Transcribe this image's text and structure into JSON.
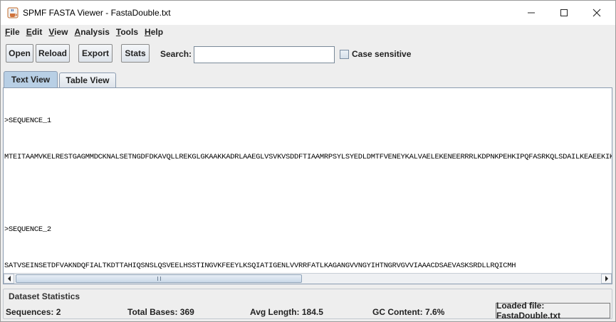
{
  "window": {
    "title": "SPMF FASTA Viewer - FastaDouble.txt",
    "app_icon": "java-coffee-icon",
    "controls": [
      "minimize-icon",
      "maximize-icon",
      "close-icon"
    ]
  },
  "menu": [
    {
      "label": "File",
      "mnemonic": "F",
      "rest": "ile"
    },
    {
      "label": "Edit",
      "mnemonic": "E",
      "rest": "dit"
    },
    {
      "label": "View",
      "mnemonic": "V",
      "rest": "iew"
    },
    {
      "label": "Analysis",
      "mnemonic": "A",
      "rest": "nalysis"
    },
    {
      "label": "Tools",
      "mnemonic": "T",
      "rest": "ools"
    },
    {
      "label": "Help",
      "mnemonic": "H",
      "rest": "elp"
    }
  ],
  "toolbar": {
    "open_label": "Open",
    "reload_label": "Reload",
    "export_label": "Export",
    "stats_label": "Stats",
    "search_label": "Search:",
    "search_value": "",
    "case_sensitive_label": "Case sensitive",
    "case_sensitive_checked": false
  },
  "tabs": [
    {
      "label": "Text View",
      "active": true
    },
    {
      "label": "Table View",
      "active": false
    }
  ],
  "text_view": {
    "lines": [
      ">SEQUENCE_1",
      "MTEITAAMVKELRESTGAGMMDCKNALSETNGDFDKAVQLLREKGLGKAAKKADRLAAEGLVSVKVSDDFTIAAMRPSYLSYEDLDMTFVENEYKALVAELEKENEERRRLKDPNKPEHKIPQFASRKQLSDAILKEAEEKIKEELKAQGKPEKIWDNIIPGKMNSFIADNSQLDSKLTLMGQFYVMDDKKTVEQVIAEKEKEFGGKIKIVEFICFEVGEGLEKKTEDFAAEVAAQL",
      "",
      ">SEQUENCE_2",
      "SATVSEINSETDFVAKNDQFIALTKDTTAHIQSNSLQSVEELHSSTINGVKFEEYLKSQIATIGENLVVRRFATLKAGANGVVNGYIHTNGRVGVVIAAACDSAEVASKSRDLLRQICMH"
    ]
  },
  "stats": {
    "title": "Dataset Statistics",
    "sequences": "Sequences: 2",
    "total_bases": "Total Bases: 369",
    "avg_length": "Avg Length: 184.5",
    "gc_content": "GC Content: 7.6%",
    "loaded_file": "Loaded file: FastaDouble.txt"
  },
  "colors": {
    "active_tab": "#b8cfe5",
    "window_bg": "#eeeeee"
  }
}
